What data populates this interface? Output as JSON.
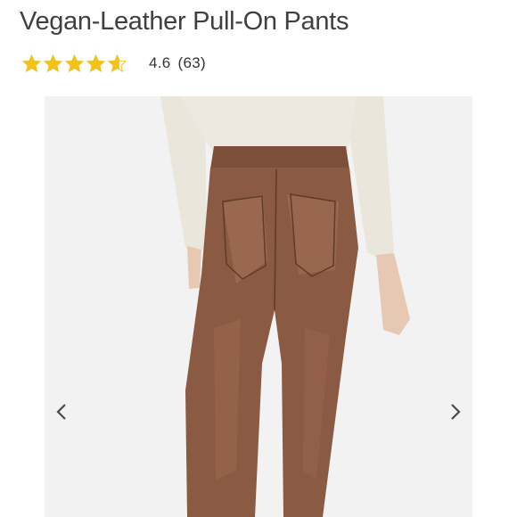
{
  "product": {
    "title": "Vegan-Leather Pull-On Pants",
    "rating": {
      "stars_value": 4.6,
      "stars_max": 5,
      "value_text": "4.6",
      "count_text": "(63)"
    },
    "gallery": {
      "image_subject": "model-wearing-brown-leather-pants",
      "prev_icon": "chevron-left-icon",
      "next_icon": "chevron-right-icon"
    }
  },
  "colors": {
    "star": "#f1c21b",
    "title": "#3f3f3f",
    "pants": "#8a5a43",
    "sweater": "#ece8df",
    "chevron": "#4a4a4a"
  }
}
